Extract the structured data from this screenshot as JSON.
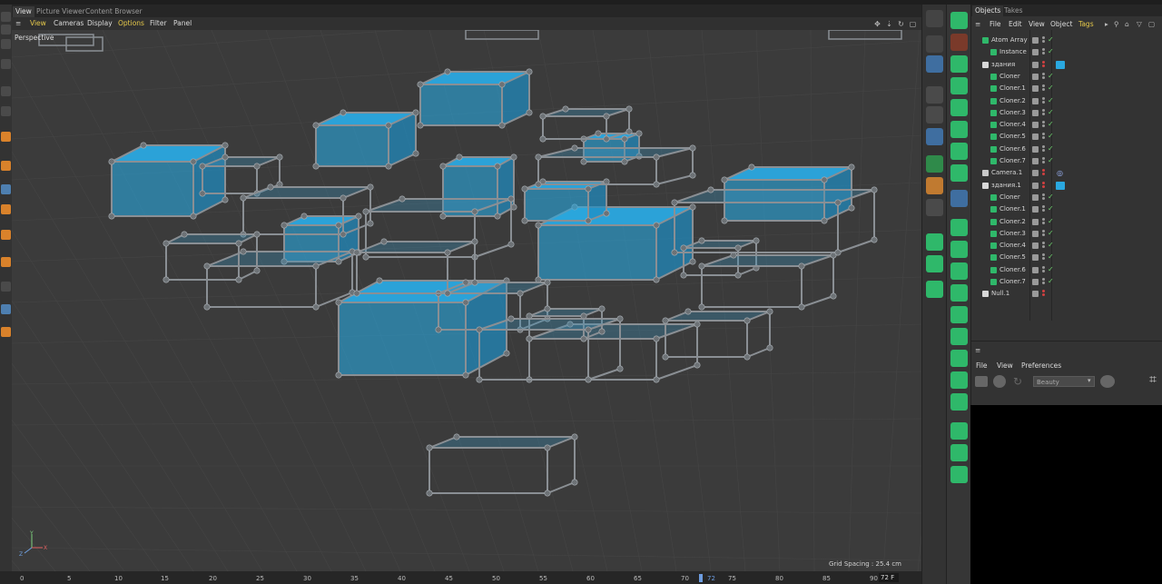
{
  "viewport": {
    "tabs": [
      "View",
      "Picture Viewer",
      "Content Browser"
    ],
    "menu": [
      "View",
      "Cameras",
      "Display",
      "Options",
      "Filter",
      "Panel"
    ],
    "label": "Perspective",
    "grid_spacing": "Grid Spacing : 25.4 cm",
    "axis_labels": {
      "x": "X",
      "y": "Y",
      "z": "Z"
    }
  },
  "timeline": {
    "ticks": [
      "0",
      "5",
      "10",
      "15",
      "20",
      "25",
      "30",
      "35",
      "40",
      "45",
      "50",
      "55",
      "60",
      "65",
      "70",
      "72",
      "75",
      "80",
      "85",
      "90"
    ],
    "current_frame": "72",
    "frame_field": "72 F"
  },
  "objects": {
    "tabs": [
      "Objects",
      "Takes"
    ],
    "menu": [
      "File",
      "Edit",
      "View",
      "Object",
      "Tags"
    ],
    "rows": [
      {
        "name": "Atom Array",
        "indent": 0,
        "icon": "atom-array-icon",
        "check": true
      },
      {
        "name": "Instance",
        "indent": 1,
        "icon": "instance-icon",
        "check": true
      },
      {
        "name": "здания",
        "indent": 0,
        "icon": "null-icon",
        "check": false,
        "tag": true
      },
      {
        "name": "Cloner",
        "indent": 1,
        "icon": "cloner-icon",
        "check": true
      },
      {
        "name": "Cloner.1",
        "indent": 1,
        "icon": "cloner-icon",
        "check": true
      },
      {
        "name": "Cloner.2",
        "indent": 1,
        "icon": "cloner-icon",
        "check": true
      },
      {
        "name": "Cloner.3",
        "indent": 1,
        "icon": "cloner-icon",
        "check": true
      },
      {
        "name": "Cloner.4",
        "indent": 1,
        "icon": "cloner-icon",
        "check": true
      },
      {
        "name": "Cloner.5",
        "indent": 1,
        "icon": "cloner-icon",
        "check": true
      },
      {
        "name": "Cloner.6",
        "indent": 1,
        "icon": "cloner-icon",
        "check": true
      },
      {
        "name": "Cloner.7",
        "indent": 1,
        "icon": "cloner-icon",
        "check": true
      },
      {
        "name": "Camera.1",
        "indent": 0,
        "icon": "camera-icon",
        "check": false,
        "camtag": true
      },
      {
        "name": "здания.1",
        "indent": 0,
        "icon": "null-icon",
        "check": false,
        "tag": true
      },
      {
        "name": "Cloner",
        "indent": 1,
        "icon": "cloner-icon",
        "check": true
      },
      {
        "name": "Cloner.1",
        "indent": 1,
        "icon": "cloner-icon",
        "check": true
      },
      {
        "name": "Cloner.2",
        "indent": 1,
        "icon": "cloner-icon",
        "check": true
      },
      {
        "name": "Cloner.3",
        "indent": 1,
        "icon": "cloner-icon",
        "check": true
      },
      {
        "name": "Cloner.4",
        "indent": 1,
        "icon": "cloner-icon",
        "check": true
      },
      {
        "name": "Cloner.5",
        "indent": 1,
        "icon": "cloner-icon",
        "check": true
      },
      {
        "name": "Cloner.6",
        "indent": 1,
        "icon": "cloner-icon",
        "check": true
      },
      {
        "name": "Cloner.7",
        "indent": 1,
        "icon": "cloner-icon",
        "check": true
      },
      {
        "name": "Null.1",
        "indent": 0,
        "icon": "null-icon",
        "check": false
      }
    ]
  },
  "preview": {
    "menu": [
      "File",
      "View",
      "Preferences"
    ],
    "render_setting": "Beauty"
  },
  "colors": {
    "accent_cyan": "#2aa8e0",
    "menu_highlight": "#e5c84a",
    "check_green": "#6cd06c",
    "icon_green": "#2fb86a"
  }
}
